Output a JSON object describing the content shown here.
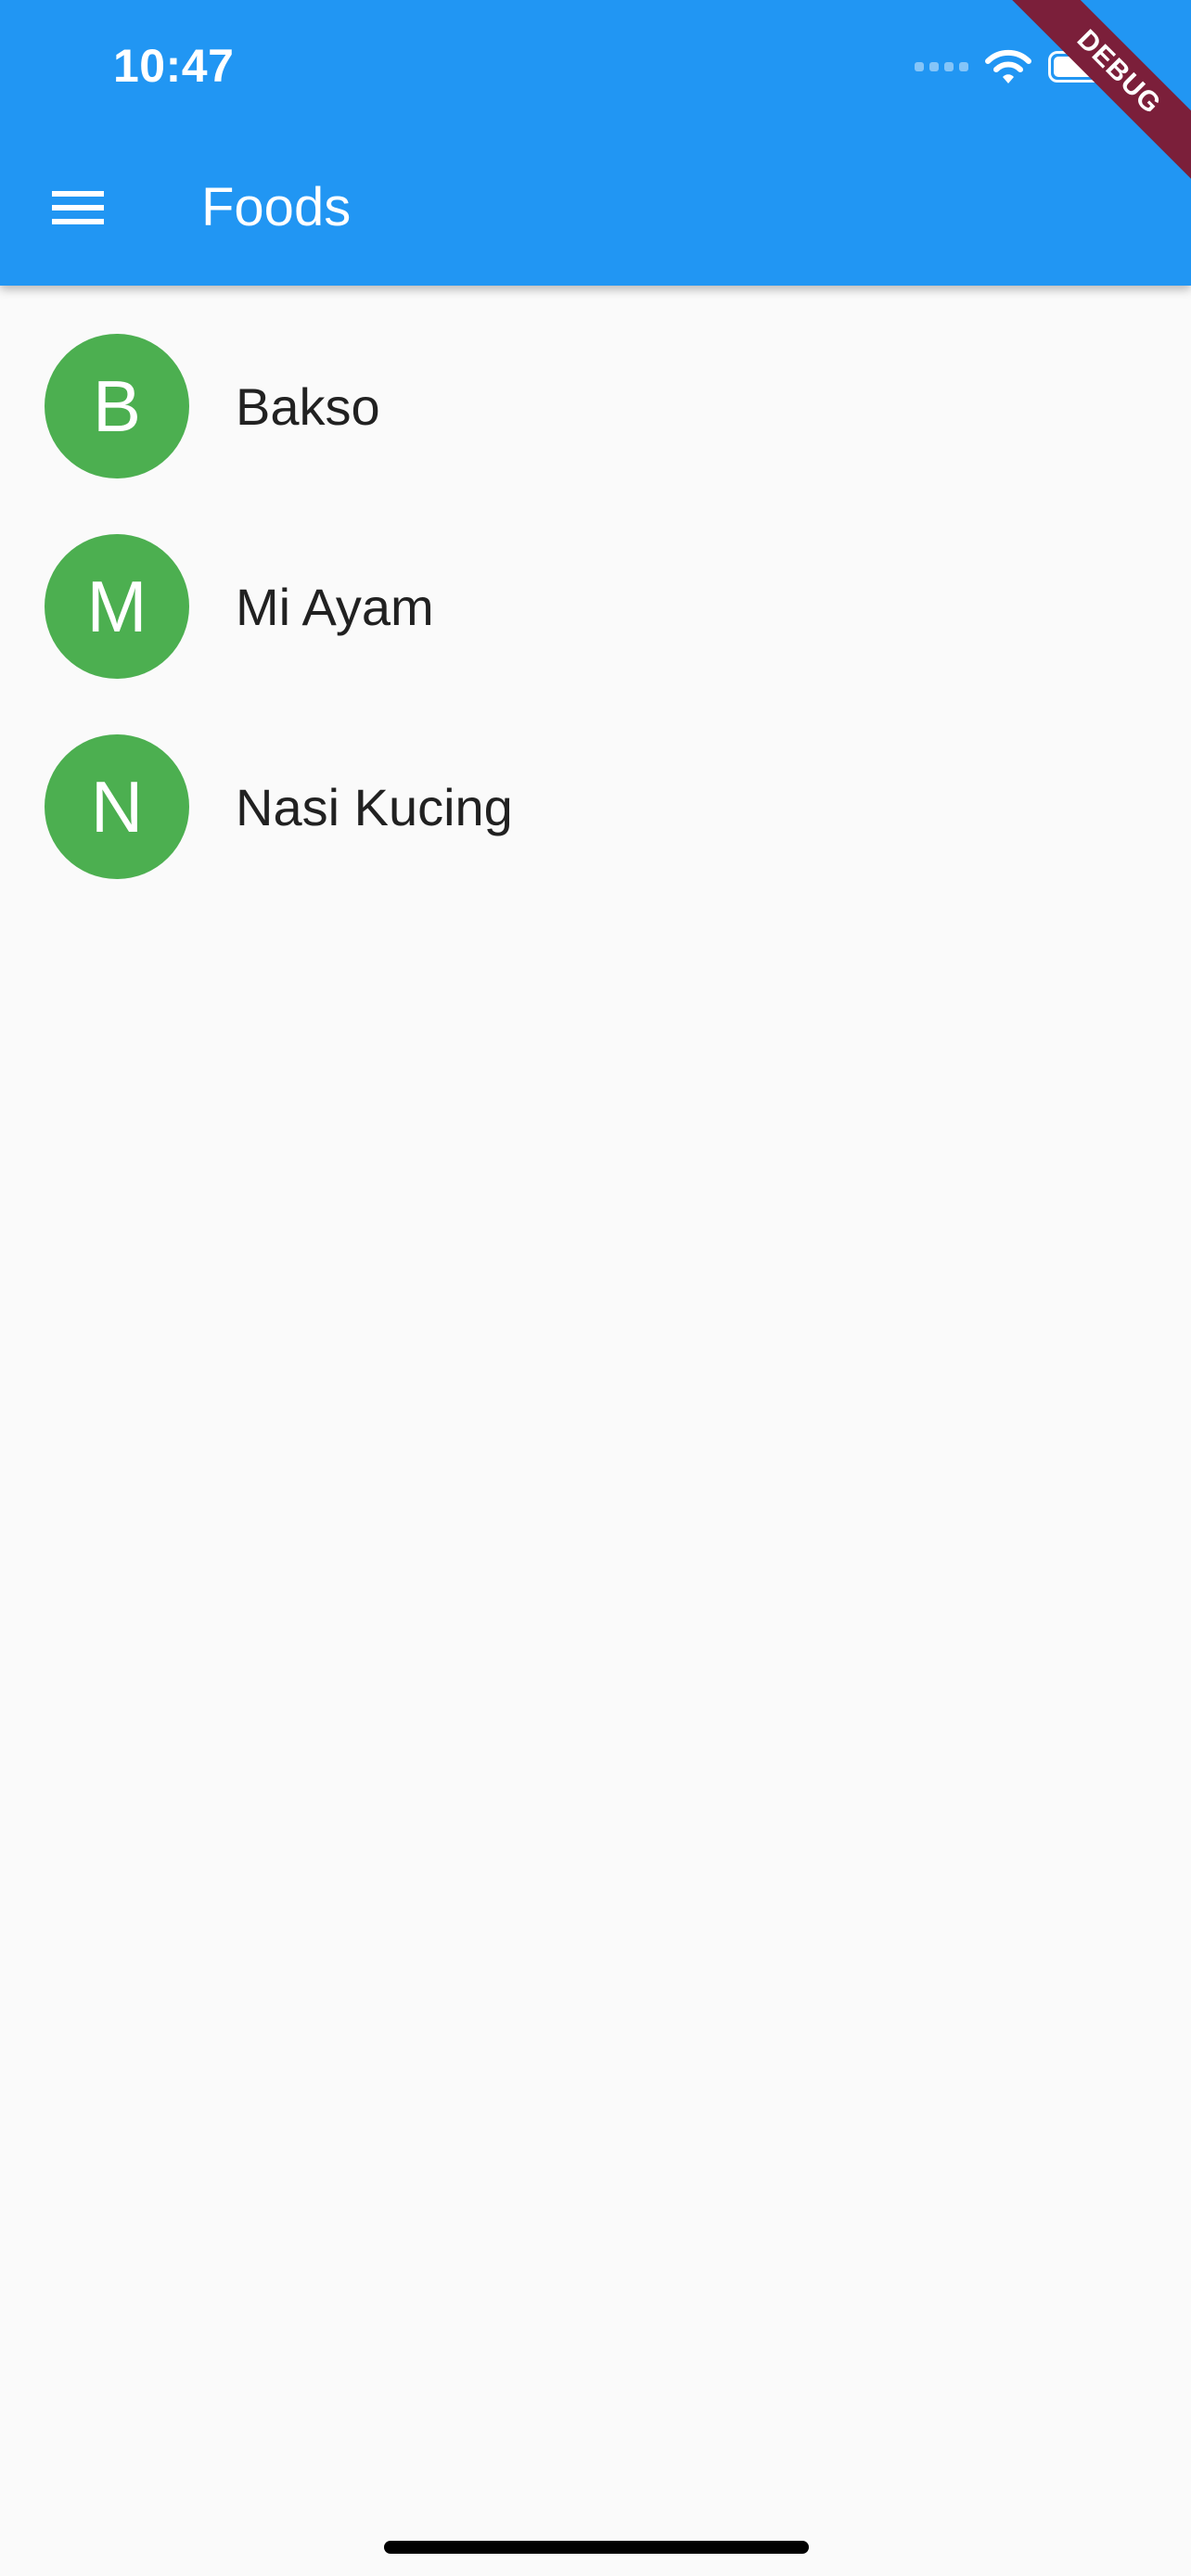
{
  "status_bar": {
    "time": "10:47",
    "icons": [
      "cellular-signal-icon",
      "wifi-icon",
      "battery-icon"
    ],
    "battery_level": 1.0
  },
  "appbar": {
    "title": "Foods",
    "menu_icon": "menu-icon",
    "background_color": "#2196F3"
  },
  "debug_banner": {
    "label": "DEBUG",
    "color": "#7B1F3A"
  },
  "foods": [
    {
      "initial": "B",
      "name": "Bakso"
    },
    {
      "initial": "M",
      "name": "Mi Ayam"
    },
    {
      "initial": "N",
      "name": "Nasi Kucing"
    }
  ],
  "colors": {
    "avatar": "#4CAF50",
    "text": "#212121",
    "background": "#FAFAFA"
  }
}
